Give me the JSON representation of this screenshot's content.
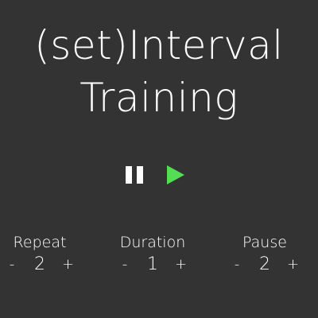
{
  "app": {
    "title_line1": "(set)Interval",
    "title_line2": "Training"
  },
  "controls": {
    "pause_icon": "pause-icon",
    "play_icon": "play-icon",
    "play_color": "#55dd55"
  },
  "settings": [
    {
      "label": "Repeat",
      "minus": "-",
      "value": "2",
      "plus": "+"
    },
    {
      "label": "Duration",
      "minus": "-",
      "value": "1",
      "plus": "+"
    },
    {
      "label": "Pause",
      "minus": "-",
      "value": "2",
      "plus": "+"
    }
  ],
  "colors": {
    "background": "#333333",
    "text": "#ffffff",
    "accent": "#55dd55"
  }
}
